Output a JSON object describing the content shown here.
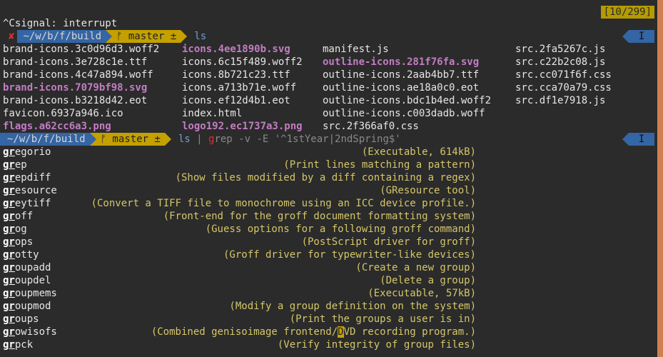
{
  "counter": "[10/299]",
  "signal": "^Csignal: interrupt",
  "prompt1": {
    "x": "✘",
    "path": "~/w/b/f/build",
    "branch": "ᚠ master ±",
    "cmd": "ls",
    "mode": "I"
  },
  "ls_columns": [
    [
      "brand-icons.3c0d96d3.woff2",
      "brand-icons.3e728c1e.ttf",
      "brand-icons.4c47a894.woff",
      "brand-icons.7079bf98.svg",
      "brand-icons.b3218d42.eot",
      "favicon.6937a946.ico",
      "flags.a62cc6a3.png"
    ],
    [
      "icons.4ee1890b.svg",
      "icons.6c15f489.woff2",
      "icons.8b721c23.ttf",
      "icons.a713b71e.woff",
      "icons.ef12d4b1.eot",
      "index.html",
      "logo192.ec1737a3.png"
    ],
    [
      "manifest.js",
      "outline-icons.281f76fa.svg",
      "outline-icons.2aab4bb7.ttf",
      "outline-icons.ae18a0c0.eot",
      "outline-icons.bdc1b4ed.woff2",
      "outline-icons.c003dadb.woff",
      "src.2f366af0.css"
    ],
    [
      "src.2fa5267c.js",
      "src.c22b2c08.js",
      "src.cc071f6f.css",
      "src.cca70a79.css",
      "src.df1e7918.js",
      "",
      ""
    ]
  ],
  "prompt2": {
    "path": "~/w/b/f/build",
    "branch": "ᚠ master ±",
    "cmd_ls": "ls",
    "pipe": " | ",
    "cmd_g": "g",
    "cmd_rest": "rep -v -E '^1stYear|2ndSpring$'",
    "mode": "I"
  },
  "completions": [
    {
      "prefix": "gr",
      "rest": "egorio",
      "desc": "(Executable, 614kB)"
    },
    {
      "prefix": "gr",
      "rest": "ep",
      "desc": "(Print lines matching a pattern)"
    },
    {
      "prefix": "gr",
      "rest": "epdiff",
      "desc": "(Show files modified by a diff containing a regex)"
    },
    {
      "prefix": "gr",
      "rest": "esource",
      "desc": "(GResource tool)"
    },
    {
      "prefix": "gr",
      "rest": "eytiff",
      "desc": "(Convert a TIFF file to monochrome using an ICC device profile.)"
    },
    {
      "prefix": "gr",
      "rest": "off",
      "desc": "(Front-end for the groff document formatting system)"
    },
    {
      "prefix": "gr",
      "rest": "og",
      "desc": "(Guess options for a following groff command)"
    },
    {
      "prefix": "gr",
      "rest": "ops",
      "desc": "(PostScript driver for groff)"
    },
    {
      "prefix": "gr",
      "rest": "otty",
      "desc": "(Groff driver for typewriter-like devices)"
    },
    {
      "prefix": "gr",
      "rest": "oupadd",
      "desc": "(Create a new group)"
    },
    {
      "prefix": "gr",
      "rest": "oupdel",
      "desc": "(Delete a group)"
    },
    {
      "prefix": "gr",
      "rest": "oupmems",
      "desc": "(Executable, 57kB)"
    },
    {
      "prefix": "gr",
      "rest": "oupmod",
      "desc": "(Modify a group definition on the system)"
    },
    {
      "prefix": "gr",
      "rest": "oups",
      "desc": "(Print the groups a user is in)"
    },
    {
      "prefix": "gr",
      "rest": "owisofs",
      "desc_a": "(Combined genisoimage frontend/",
      "desc_cursor": "D",
      "desc_b": "VD recording program.)"
    },
    {
      "prefix": "gr",
      "rest": "pck",
      "desc": "(Verify integrity of group files)"
    }
  ]
}
